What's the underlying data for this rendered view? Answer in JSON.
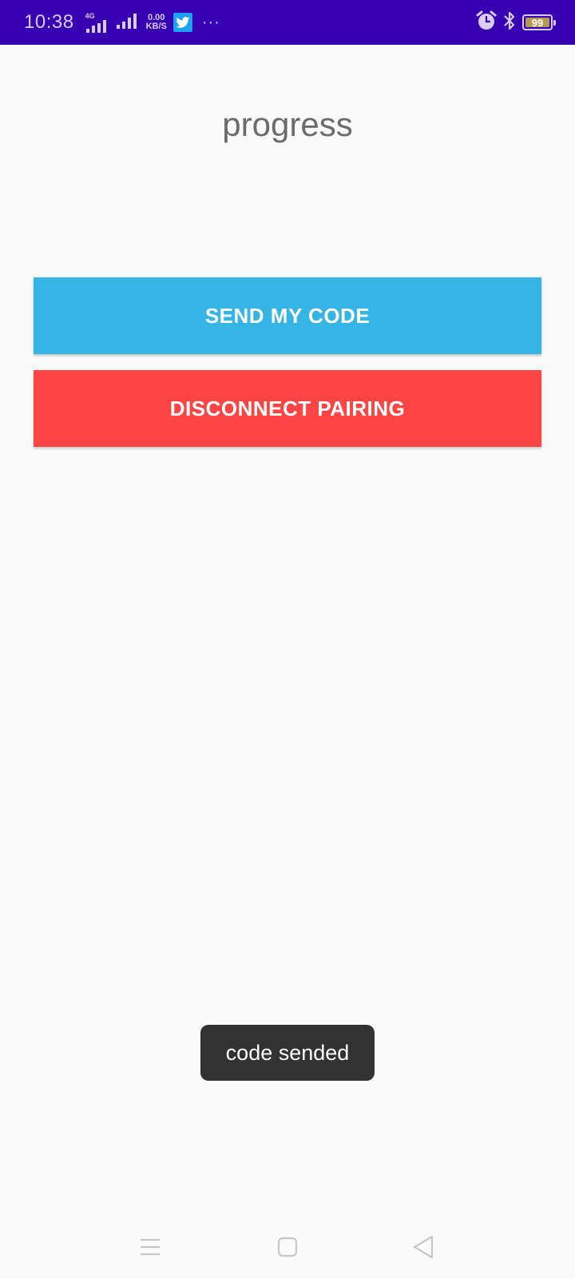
{
  "status_bar": {
    "time": "10:38",
    "network_type": "4G",
    "speed_value": "0.00",
    "speed_unit": "KB/S",
    "battery": "99",
    "battery_level": 0.99,
    "notification_app_icon": "twitter-icon",
    "overflow": "···",
    "icons": [
      "signal-icon",
      "signal-icon",
      "twitter-icon",
      "alarm-icon",
      "bluetooth-icon",
      "battery-icon"
    ]
  },
  "page": {
    "title": "progress"
  },
  "buttons": {
    "send_label": "SEND MY CODE",
    "disconnect_label": "DISCONNECT PAIRING"
  },
  "toast": {
    "message": "code sended"
  },
  "nav_bar": {
    "icons": [
      "menu-icon",
      "home-icon",
      "back-icon"
    ]
  },
  "colors": {
    "status_bar": "#3700b3",
    "send_button": "#35b5e5",
    "disconnect_button": "#ff4444",
    "toast_background": "#323232",
    "background": "#fafafa"
  }
}
